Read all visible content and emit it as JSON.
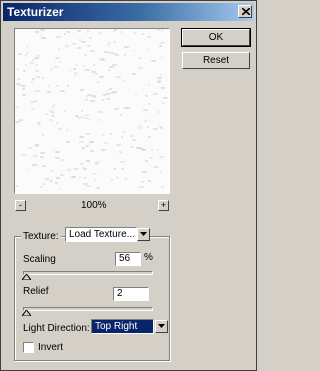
{
  "window": {
    "title": "Texturizer"
  },
  "preview": {
    "zoom_level": "100%",
    "zoom_out": "-",
    "zoom_in": "+"
  },
  "buttons": {
    "ok": "OK",
    "reset": "Reset"
  },
  "options": {
    "texture_label": "Texture:",
    "texture_value": "Load Texture...",
    "scaling_label": "Scaling",
    "scaling_value": "56",
    "scaling_unit": "%",
    "relief_label": "Relief",
    "relief_value": "2",
    "light_label": "Light Direction:",
    "light_value": "Top Right",
    "invert_label": "Invert",
    "invert_checked": false
  }
}
